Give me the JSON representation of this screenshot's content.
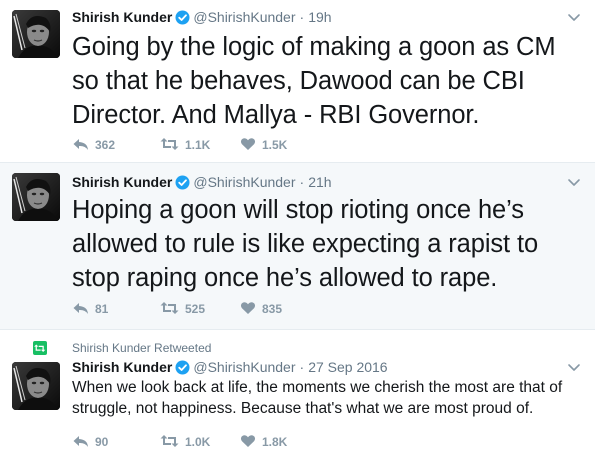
{
  "tweets": [
    {
      "name": "Shirish Kunder",
      "handle": "@ShirishKunder",
      "separator": "·",
      "time": "19h",
      "text": "Going by the logic of making a goon as CM so that he behaves, Dawood can be CBI Director. And Mallya - RBI Governor.",
      "replies": "362",
      "retweets": "1.1K",
      "likes": "1.5K"
    },
    {
      "name": "Shirish Kunder",
      "handle": "@ShirishKunder",
      "separator": "·",
      "time": "21h",
      "text": "Hoping a goon will stop rioting once he’s allowed to rule is like expecting a rapist to stop raping once he’s allowed to rape.",
      "replies": "81",
      "retweets": "525",
      "likes": "835"
    },
    {
      "context": "Shirish Kunder Retweeted",
      "name": "Shirish Kunder",
      "handle": "@ShirishKunder",
      "separator": "·",
      "time": "27 Sep 2016",
      "text": "When we look back at life, the moments we cherish the most are that of struggle, not happiness. Because that's what we are most proud of.",
      "replies": "90",
      "retweets": "1.0K",
      "likes": "1.8K"
    }
  ],
  "icons": {
    "verified": "verified-badge-icon",
    "caret": "chevron-down-icon",
    "reply": "reply-icon",
    "retweet": "retweet-icon",
    "like": "heart-icon",
    "retweeted": "retweet-context-icon"
  },
  "colors": {
    "verified": "#1da1f2",
    "action_gray": "#8899a6",
    "retweet_green": "#17bf63",
    "alt_background": "#f5f8fa"
  }
}
